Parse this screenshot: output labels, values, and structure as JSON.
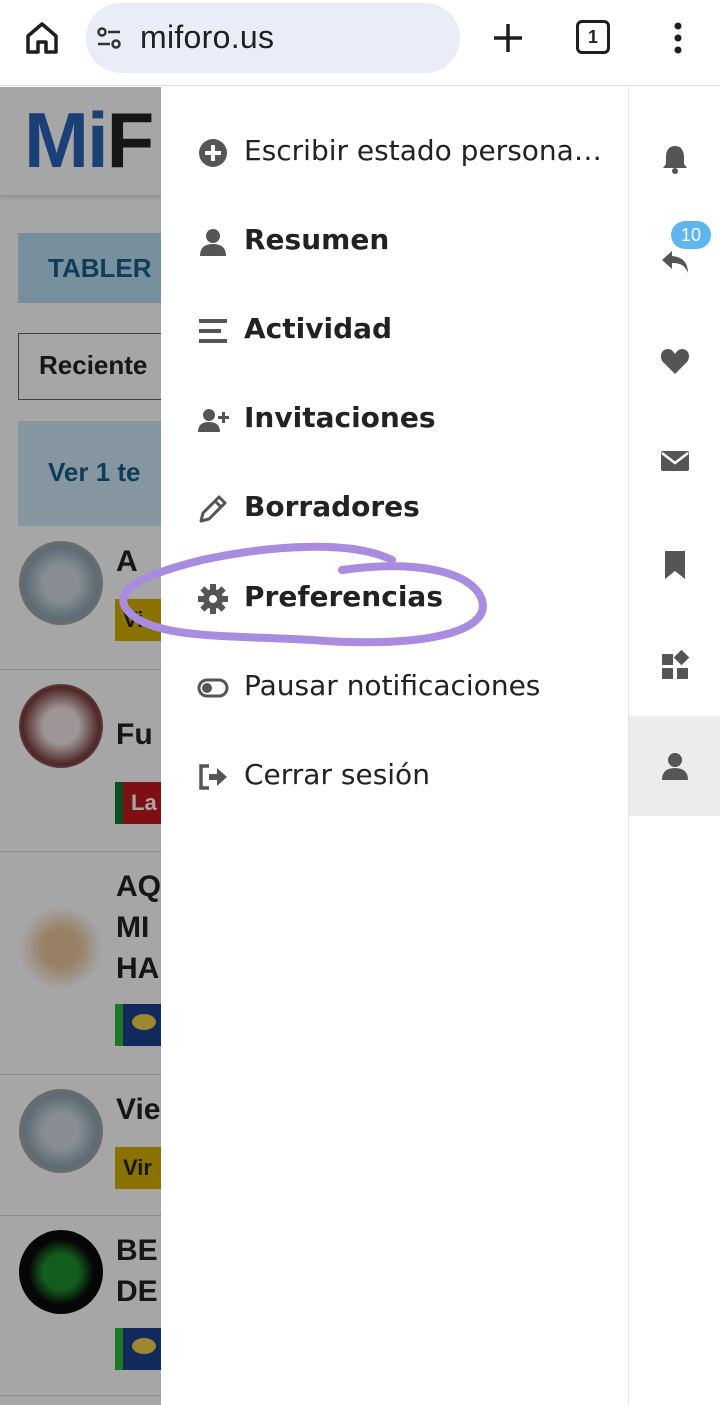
{
  "browser": {
    "url": "miforo.us",
    "tab_count": "1"
  },
  "page": {
    "logo_mi": "Mi",
    "logo_f": "F",
    "tab_partial": "TABLER",
    "select_partial": "Reciente",
    "banner_partial": "Ver 1 te",
    "topics": [
      {
        "title": "A",
        "category": "Vi",
        "cat_bg": "#d4b000",
        "cat_fg": "#222"
      },
      {
        "title": "Fu",
        "category": "La",
        "cat_bg": "#c2191f",
        "cat_fg": "#fff"
      },
      {
        "title": "AQ\nMI\nHA",
        "category": "",
        "cat_bg": "#1c3f8c",
        "cat_fg": "#fff"
      },
      {
        "title": "Vie",
        "category": "Vir",
        "cat_bg": "#d4b000",
        "cat_fg": "#222"
      },
      {
        "title": "BE\nDE",
        "category": "",
        "cat_bg": "#1c3f8c",
        "cat_fg": "#fff"
      }
    ]
  },
  "menu": {
    "items": [
      {
        "label": "Escribir estado persona…",
        "icon": "plus-circle-icon"
      },
      {
        "label": "Resumen",
        "icon": "user-icon"
      },
      {
        "label": "Actividad",
        "icon": "list-icon"
      },
      {
        "label": "Invitaciones",
        "icon": "user-plus-icon"
      },
      {
        "label": "Borradores",
        "icon": "pencil-icon"
      },
      {
        "label": "Preferencias",
        "icon": "gear-icon"
      },
      {
        "label": "Pausar notificaciones",
        "icon": "toggle-icon"
      },
      {
        "label": "Cerrar sesión",
        "icon": "sign-out-icon"
      }
    ]
  },
  "rail": {
    "reply_badge": "10",
    "items": [
      "bell-icon",
      "reply-icon",
      "heart-icon",
      "envelope-icon",
      "bookmark-icon",
      "widgets-icon",
      "user-icon"
    ]
  },
  "colors": {
    "accent": "#2a63b8",
    "badge": "#5fb6ef",
    "highlight": "#a98be0",
    "icon_gray": "#555"
  }
}
